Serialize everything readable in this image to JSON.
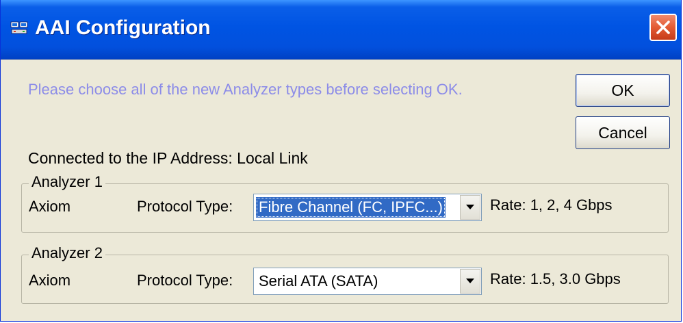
{
  "window": {
    "title": "AAI Configuration",
    "icon": "analyzer-app-icon",
    "close_icon": "close-icon"
  },
  "instructions": "Please choose all of the new Analyzer types before selecting OK.",
  "buttons": {
    "ok_label": "OK",
    "cancel_label": "Cancel"
  },
  "connection": {
    "text": "Connected to the IP Address: Local Link"
  },
  "analyzers": [
    {
      "legend": "Analyzer 1",
      "model": "Axiom",
      "protocol_label": "Protocol Type:",
      "protocol_value": "Fibre Channel (FC, IPFC...)",
      "rate": "Rate: 1, 2, 4 Gbps"
    },
    {
      "legend": "Analyzer 2",
      "model": "Axiom",
      "protocol_label": "Protocol Type:",
      "protocol_value": "Serial ATA (SATA)",
      "rate": "Rate: 1.5, 3.0 Gbps"
    }
  ],
  "colors": {
    "title_bar": "#0054e3",
    "instruction_text": "#8c8ce8",
    "selection": "#316ac5",
    "dialog_bg": "#ece9d8"
  }
}
